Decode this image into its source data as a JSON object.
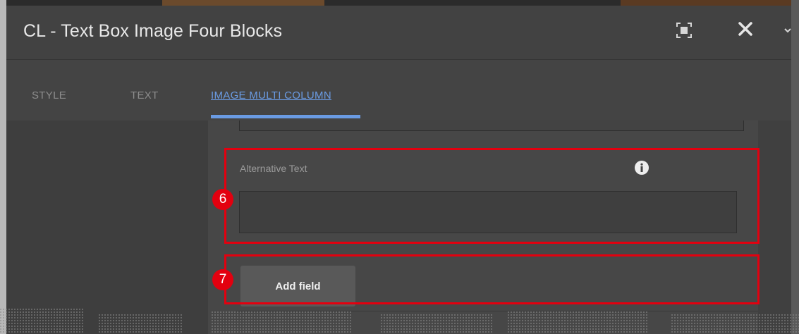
{
  "dialog": {
    "title": "CL - Text Box Image Four Blocks"
  },
  "icons": {
    "fullscreen": "fullscreen-icon",
    "close": "close-icon",
    "more": "chevron-down-icon",
    "info": "info-icon"
  },
  "tabs": [
    {
      "label": "STYLE",
      "active": false
    },
    {
      "label": "TEXT",
      "active": false
    },
    {
      "label": "IMAGE MULTI COLUMN",
      "active": true
    }
  ],
  "form": {
    "alt_text_label": "Alternative Text",
    "alt_text_value": "",
    "add_field_label": "Add field"
  },
  "annotations": {
    "marker_6": "6",
    "marker_7": "7"
  },
  "colors": {
    "accent_tab": "#6a9be3",
    "annotation_red": "#e3000f"
  }
}
